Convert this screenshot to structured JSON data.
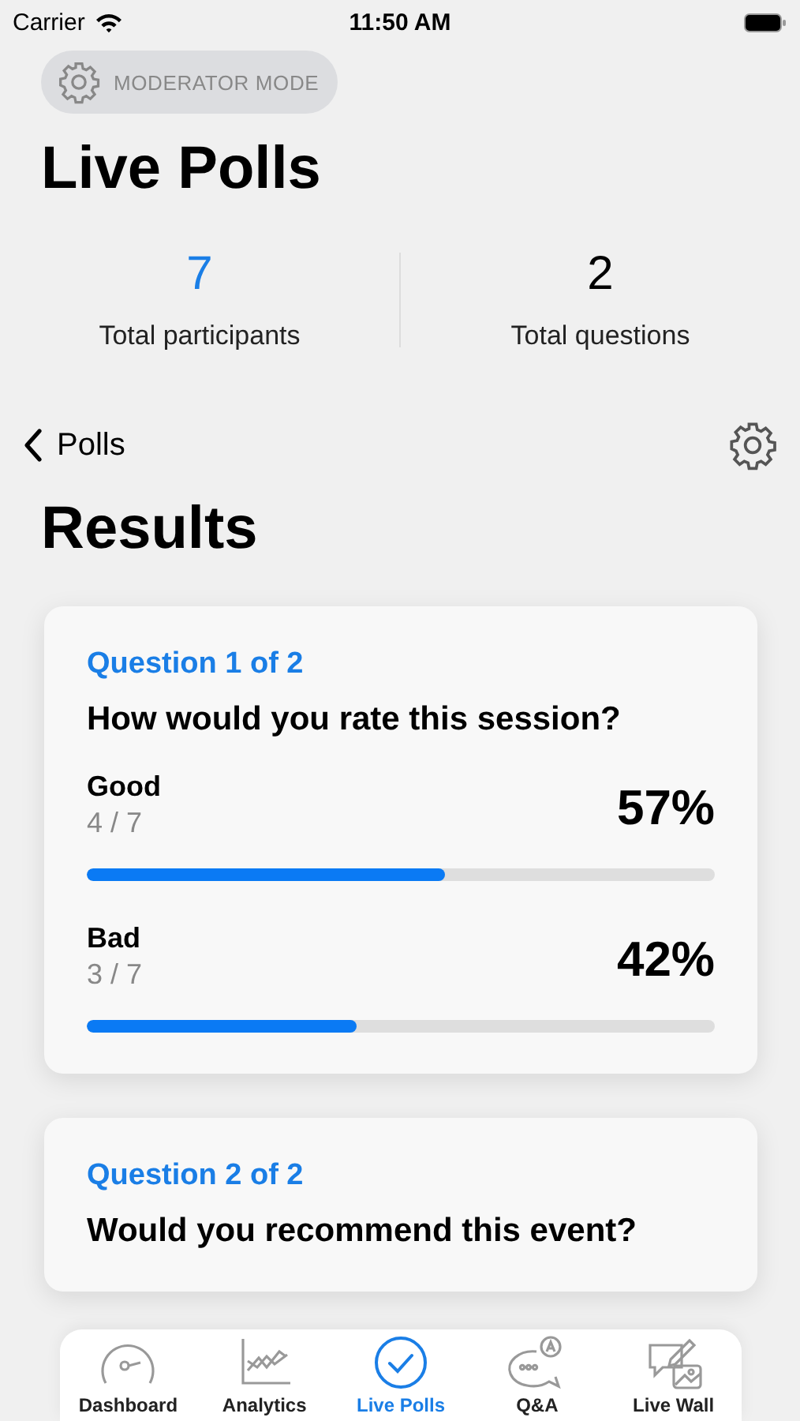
{
  "status_bar": {
    "carrier": "Carrier",
    "time": "11:50 AM"
  },
  "mode_badge": "MODERATOR MODE",
  "title": "Live Polls",
  "stats": [
    {
      "value": "7",
      "label": "Total participants",
      "highlight": true
    },
    {
      "value": "2",
      "label": "Total questions",
      "highlight": false
    }
  ],
  "nav": {
    "back": "Polls"
  },
  "section_title": "Results",
  "questions": [
    {
      "counter": "Question 1 of 2",
      "text": "How would you rate this session?",
      "options": [
        {
          "label": "Good",
          "count": "4 / 7",
          "percent": "57%",
          "level": 0.57
        },
        {
          "label": "Bad",
          "count": "3 / 7",
          "percent": "42%",
          "level": 0.43
        }
      ]
    },
    {
      "counter": "Question 2 of 2",
      "text": "Would you recommend this event?"
    }
  ],
  "tabs": [
    {
      "label": "Dashboard",
      "selected": false
    },
    {
      "label": "Analytics",
      "selected": false
    },
    {
      "label": "Live Polls",
      "selected": true
    },
    {
      "label": "Q&A",
      "selected": false
    },
    {
      "label": "Live Wall",
      "selected": false
    }
  ]
}
